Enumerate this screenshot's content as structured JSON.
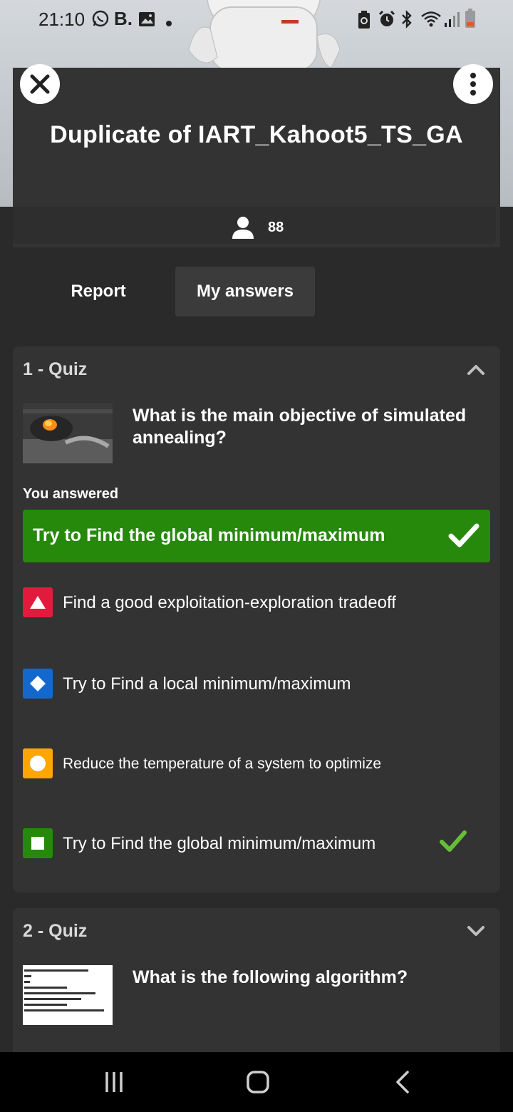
{
  "status_bar": {
    "time": "21:10",
    "icons": [
      "whatsapp-icon",
      "b-app-icon",
      "gallery-icon",
      "dot-icon",
      "battery-saver-icon",
      "alarm-icon",
      "bluetooth-icon",
      "wifi-icon",
      "signal-icon",
      "battery-icon"
    ],
    "b_label": "B."
  },
  "header": {
    "title": "Duplicate of IART_Kahoot5_TS_GA",
    "players_count": "88"
  },
  "tabs": [
    {
      "label": "Report",
      "active": false
    },
    {
      "label": "My answers",
      "active": true
    }
  ],
  "questions": [
    {
      "label": "1 - Quiz",
      "expanded": true,
      "question": "What is the main objective of simulated annealing?",
      "you_answered_label": "You answered",
      "your_answer": "Try to Find the global minimum/maximum",
      "your_answer_correct": true,
      "choices": [
        {
          "shape": "triangle",
          "color": "#e21b3c",
          "text": "Find a good exploitation-exploration tradeoff",
          "correct": false
        },
        {
          "shape": "diamond",
          "color": "#1368ce",
          "text": "Try to Find a local minimum/maximum",
          "correct": false
        },
        {
          "shape": "circle",
          "color": "#ffa602",
          "text": "Reduce the temperature of a system to optimize",
          "correct": false
        },
        {
          "shape": "square",
          "color": "#26890c",
          "text": "Try to Find the global minimum/maximum",
          "correct": true
        }
      ]
    },
    {
      "label": "2 - Quiz",
      "expanded": false,
      "question": "What is the following algorithm?"
    }
  ],
  "navbar": [
    "recent-apps-icon",
    "home-icon",
    "back-icon"
  ],
  "colors": {
    "correct_green": "#26890c",
    "card_bg": "#333333",
    "page_bg": "#2a2a2a"
  }
}
